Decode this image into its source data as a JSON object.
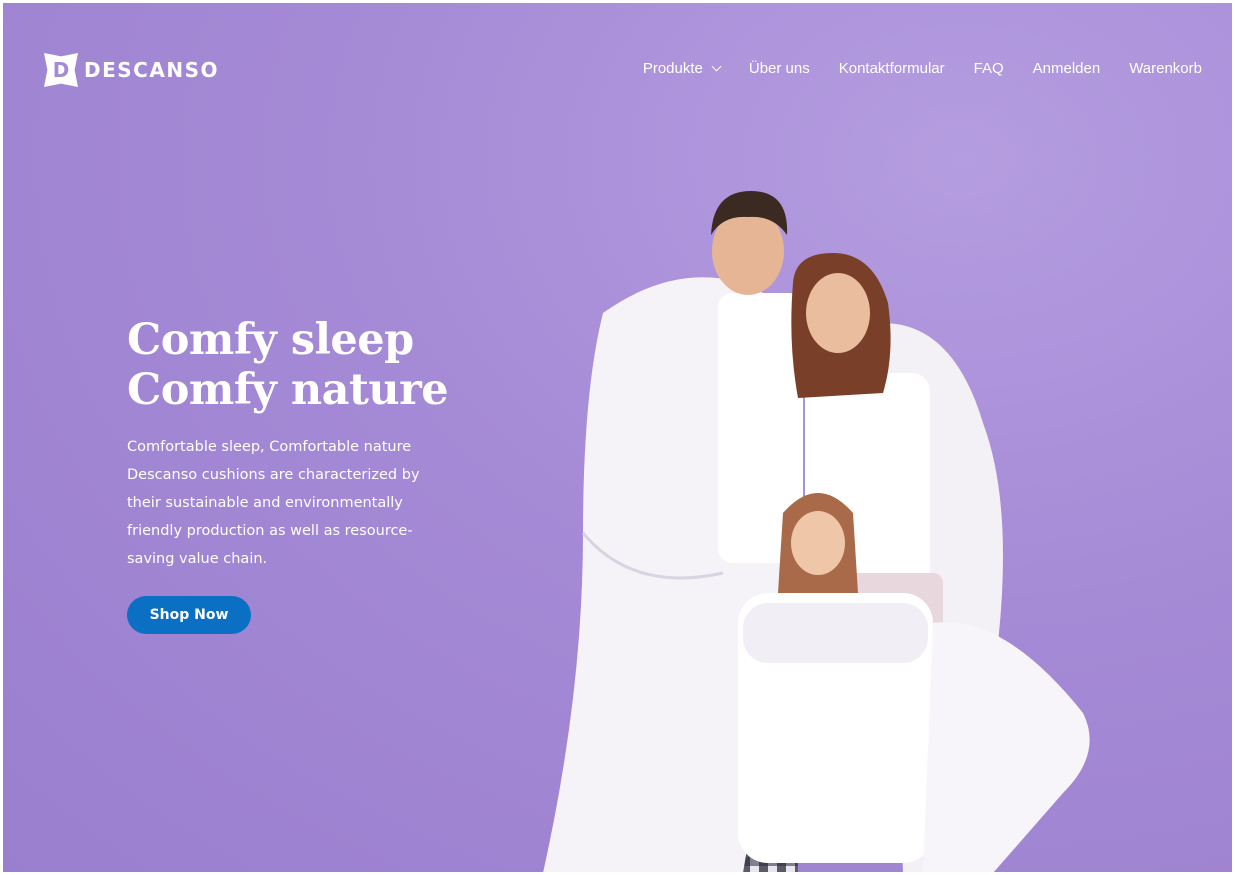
{
  "brand": {
    "logo_letter": "D",
    "name": "DESCANSO"
  },
  "nav": {
    "items": [
      {
        "label": "Produkte",
        "has_dropdown": true
      },
      {
        "label": "Über uns"
      },
      {
        "label": "Kontaktformular"
      },
      {
        "label": "FAQ"
      },
      {
        "label": "Anmelden"
      },
      {
        "label": "Warenkorb"
      }
    ]
  },
  "hero": {
    "title_line1": "Comfy sleep",
    "title_line2": "Comfy nature",
    "description": "Comfortable sleep, Comfortable nature Descanso cushions are characterized by their sustainable and environmentally friendly production as well as resource-saving value chain.",
    "cta_label": "Shop Now"
  },
  "colors": {
    "background": "#a58ad6",
    "cta": "#0b6fc4",
    "text": "#ffffff"
  },
  "icons": {
    "dropdown": "chevron-down-icon"
  }
}
